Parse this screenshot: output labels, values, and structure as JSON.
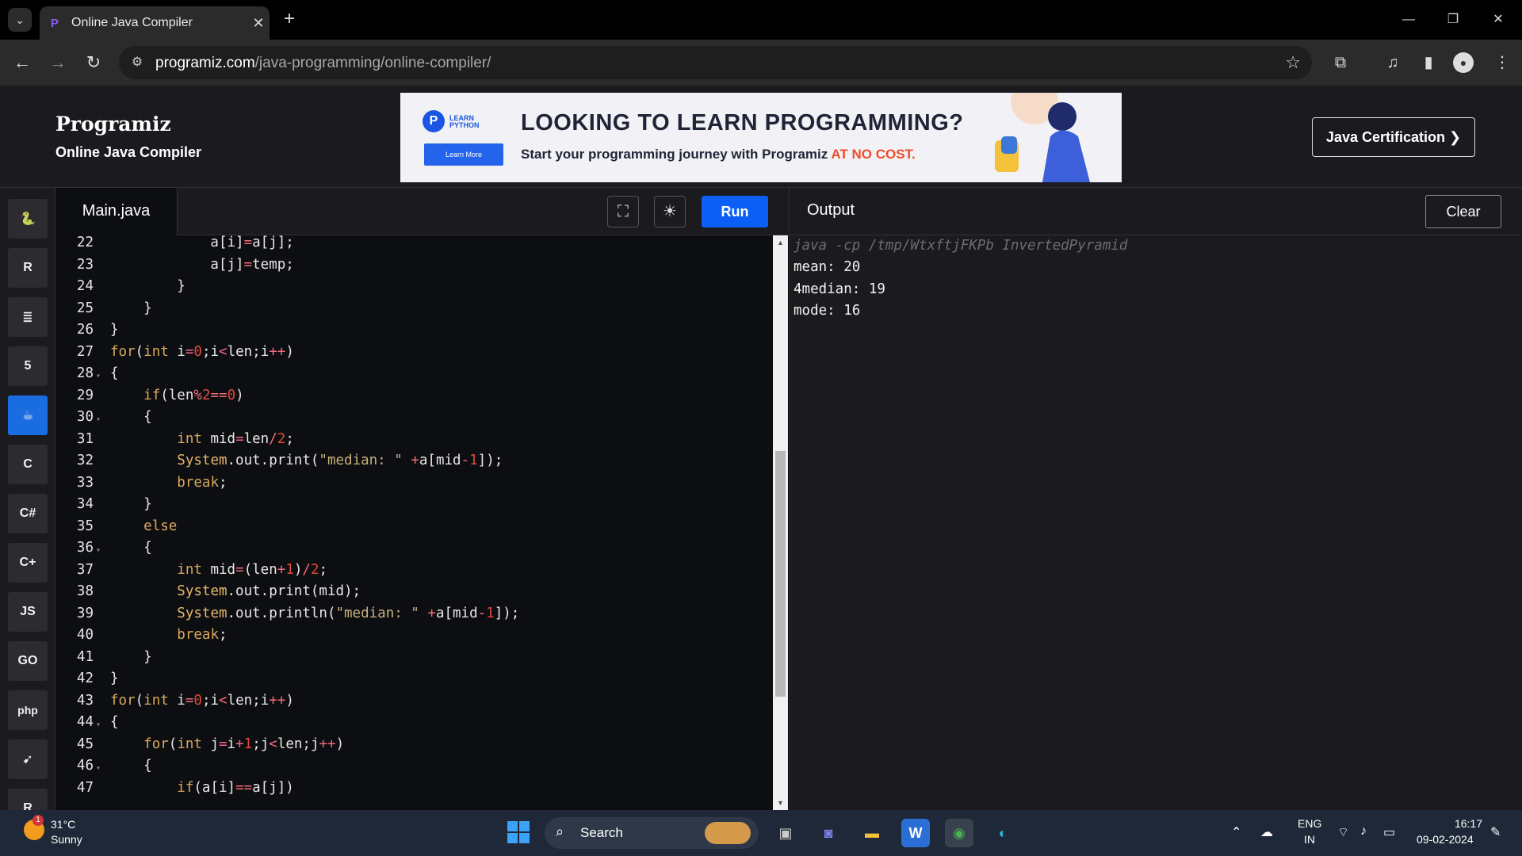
{
  "browser": {
    "tab_title": "Online Java Compiler",
    "url_host": "programiz.com",
    "url_path": "/java-programming/online-compiler/"
  },
  "site": {
    "logo": "Programiz",
    "subtitle": "Online Java Compiler",
    "cert_button": "Java Certification ❯"
  },
  "banner": {
    "badge_line1": "LEARN",
    "badge_line2": "PYTHON",
    "learn_more": "Learn More",
    "headline": "LOOKING TO LEARN PROGRAMMING?",
    "tagline": "Start your programming journey with Programiz ",
    "tagline_highlight": "AT NO COST."
  },
  "languages": [
    {
      "name": "python",
      "glyph": "🐍"
    },
    {
      "name": "r",
      "glyph": "R"
    },
    {
      "name": "sql",
      "glyph": "≣"
    },
    {
      "name": "html",
      "glyph": "5"
    },
    {
      "name": "java",
      "glyph": "☕",
      "active": true
    },
    {
      "name": "c",
      "glyph": "C"
    },
    {
      "name": "csharp",
      "glyph": "C#"
    },
    {
      "name": "cpp",
      "glyph": "C+"
    },
    {
      "name": "js",
      "glyph": "JS"
    },
    {
      "name": "go",
      "glyph": "GO"
    },
    {
      "name": "php",
      "glyph": "php"
    },
    {
      "name": "swift",
      "glyph": "➹"
    },
    {
      "name": "rust",
      "glyph": "R"
    }
  ],
  "editor": {
    "file_name": "Main.java",
    "run_label": "Run"
  },
  "code_lines": [
    {
      "n": "22",
      "fold": false,
      "html": "            a[i]<span class='op'>=</span>a[j];"
    },
    {
      "n": "23",
      "fold": false,
      "html": "            a[j]<span class='op'>=</span>temp;"
    },
    {
      "n": "24",
      "fold": false,
      "html": "        }"
    },
    {
      "n": "25",
      "fold": false,
      "html": "    }"
    },
    {
      "n": "26",
      "fold": false,
      "html": "}"
    },
    {
      "n": "27",
      "fold": false,
      "html": "<span class='kw'>for</span>(<span class='kw'>int</span> i<span class='op'>=</span><span class='num'>0</span>;i<span class='op'>&lt;</span>len;i<span class='op'>++</span>)"
    },
    {
      "n": "28",
      "fold": true,
      "html": "{"
    },
    {
      "n": "29",
      "fold": false,
      "html": "    <span class='kw'>if</span>(len<span class='op'>%</span><span class='num'>2</span><span class='op'>==</span><span class='num'>0</span>)"
    },
    {
      "n": "30",
      "fold": true,
      "html": "    {"
    },
    {
      "n": "31",
      "fold": false,
      "html": "        <span class='kw'>int</span> mid<span class='op'>=</span>len<span class='op'>/</span><span class='num'>2</span>;"
    },
    {
      "n": "32",
      "fold": false,
      "html": "        <span class='fn'>System</span>.out.print(<span class='str'>\"median: \"</span> <span class='op'>+</span>a[mid<span class='op'>-</span><span class='num'>1</span>]);"
    },
    {
      "n": "33",
      "fold": false,
      "html": "        <span class='kw'>break</span>;"
    },
    {
      "n": "34",
      "fold": false,
      "html": "    }"
    },
    {
      "n": "35",
      "fold": false,
      "html": "    <span class='kw'>else</span>"
    },
    {
      "n": "36",
      "fold": true,
      "html": "    {"
    },
    {
      "n": "37",
      "fold": false,
      "html": "        <span class='kw'>int</span> mid<span class='op'>=</span>(len<span class='op'>+</span><span class='num'>1</span>)<span class='op'>/</span><span class='num'>2</span>;"
    },
    {
      "n": "38",
      "fold": false,
      "html": "        <span class='fn'>System</span>.out.print(mid);"
    },
    {
      "n": "39",
      "fold": false,
      "html": "        <span class='fn'>System</span>.out.println(<span class='str'>\"median: \"</span> <span class='op'>+</span>a[mid<span class='op'>-</span><span class='num'>1</span>]);"
    },
    {
      "n": "40",
      "fold": false,
      "html": "        <span class='kw'>break</span>;"
    },
    {
      "n": "41",
      "fold": false,
      "html": "    }"
    },
    {
      "n": "42",
      "fold": false,
      "html": "}"
    },
    {
      "n": "43",
      "fold": false,
      "html": "<span class='kw'>for</span>(<span class='kw'>int</span> i<span class='op'>=</span><span class='num'>0</span>;i<span class='op'>&lt;</span>len;i<span class='op'>++</span>)"
    },
    {
      "n": "44",
      "fold": true,
      "html": "{"
    },
    {
      "n": "45",
      "fold": false,
      "html": "    <span class='kw'>for</span>(<span class='kw'>int</span> j<span class='op'>=</span>i<span class='op'>+</span><span class='num'>1</span>;j<span class='op'>&lt;</span>len;j<span class='op'>++</span>)"
    },
    {
      "n": "46",
      "fold": true,
      "html": "    {"
    },
    {
      "n": "47",
      "fold": false,
      "html": "        <span class='kw'>if</span>(a[i]<span class='op'>==</span>a[j])"
    }
  ],
  "output": {
    "title": "Output",
    "clear_label": "Clear",
    "command": "java -cp /tmp/WtxftjFKPb InvertedPyramid",
    "lines": [
      "mean: 20",
      "4median: 19",
      "mode: 16"
    ]
  },
  "taskbar": {
    "temperature": "31°C",
    "condition": "Sunny",
    "weather_badge": "1",
    "search_label": "Search",
    "lang_line1": "ENG",
    "lang_line2": "IN",
    "time": "16:17",
    "date": "09-02-2024"
  }
}
